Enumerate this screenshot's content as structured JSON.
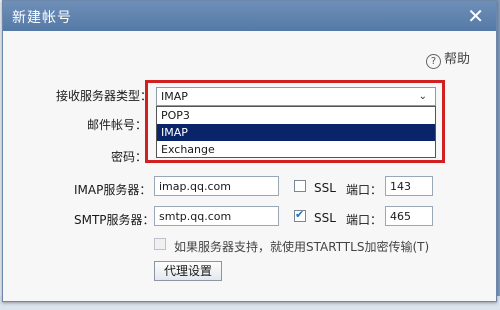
{
  "dialog": {
    "title": "新建帐号",
    "close_icon": "close-icon",
    "help": "帮助",
    "help_icon": "question-circle-icon"
  },
  "form": {
    "server_type_label": "接收服务器类型：",
    "server_type_value": "IMAP",
    "server_type_options": [
      "POP3",
      "IMAP",
      "Exchange"
    ],
    "selected_option": "IMAP",
    "account_label": "邮件帐号：",
    "password_label": "密码：",
    "imap_label": "IMAP服务器：",
    "imap_value": "imap.qq.com",
    "imap_ssl_label": "SSL",
    "imap_ssl_checked": false,
    "imap_port_label": "端口：",
    "imap_port_value": "143",
    "smtp_label": "SMTP服务器：",
    "smtp_value": "smtp.qq.com",
    "smtp_ssl_label": "SSL",
    "smtp_ssl_checked": true,
    "smtp_port_label": "端口：",
    "smtp_port_value": "465",
    "starttls_label": "如果服务器支持，就使用STARTTLS加密传输(T)",
    "starttls_checked": false,
    "proxy_button": "代理设置"
  },
  "colors": {
    "titlebar": "#5f82ad",
    "highlight_border": "#d02020",
    "selected_option_bg": "#0a246a"
  }
}
